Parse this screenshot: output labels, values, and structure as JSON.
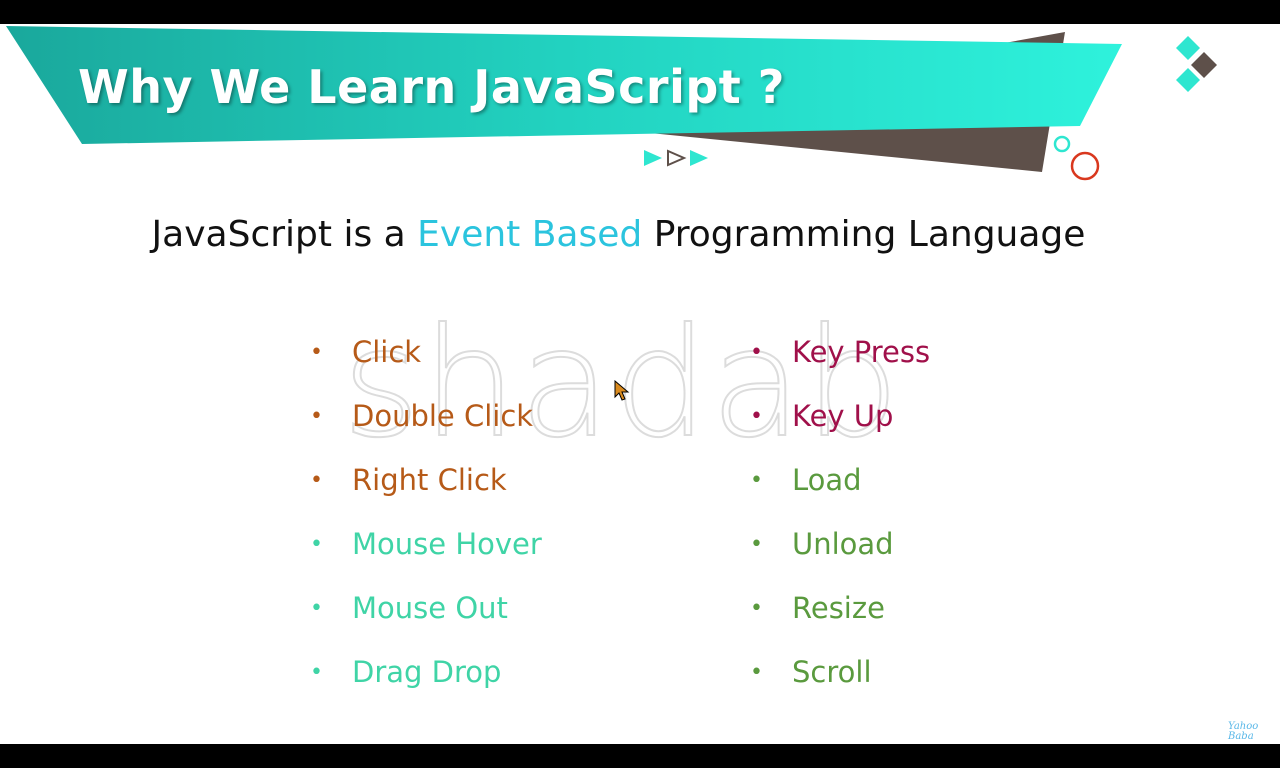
{
  "slide": {
    "title": "Why We Learn JavaScript ?",
    "subtitle_pre": "JavaScript is a ",
    "subtitle_highlight": "Event Based",
    "subtitle_post": " Programming Language",
    "watermark": "shadab",
    "left_items": [
      "Click",
      "Double Click",
      "Right Click",
      "Mouse Hover",
      "Mouse Out",
      "Drag Drop"
    ],
    "right_items": [
      "Key Press",
      "Key Up",
      "Load",
      "Unload",
      "Resize",
      "Scroll"
    ],
    "logo_line1": "Yahoo",
    "logo_line2": "Baba"
  },
  "colors": {
    "banner": "#2ee6d0",
    "highlight": "#2bc4de",
    "brown": "#b65a18",
    "teal": "#3fd4a6",
    "maroon": "#a0104a",
    "green": "#5a9a3e"
  },
  "icons": [
    "diamond-logo-icon",
    "play-arrows-icon",
    "circle-decoration-icon",
    "mouse-cursor-icon"
  ]
}
